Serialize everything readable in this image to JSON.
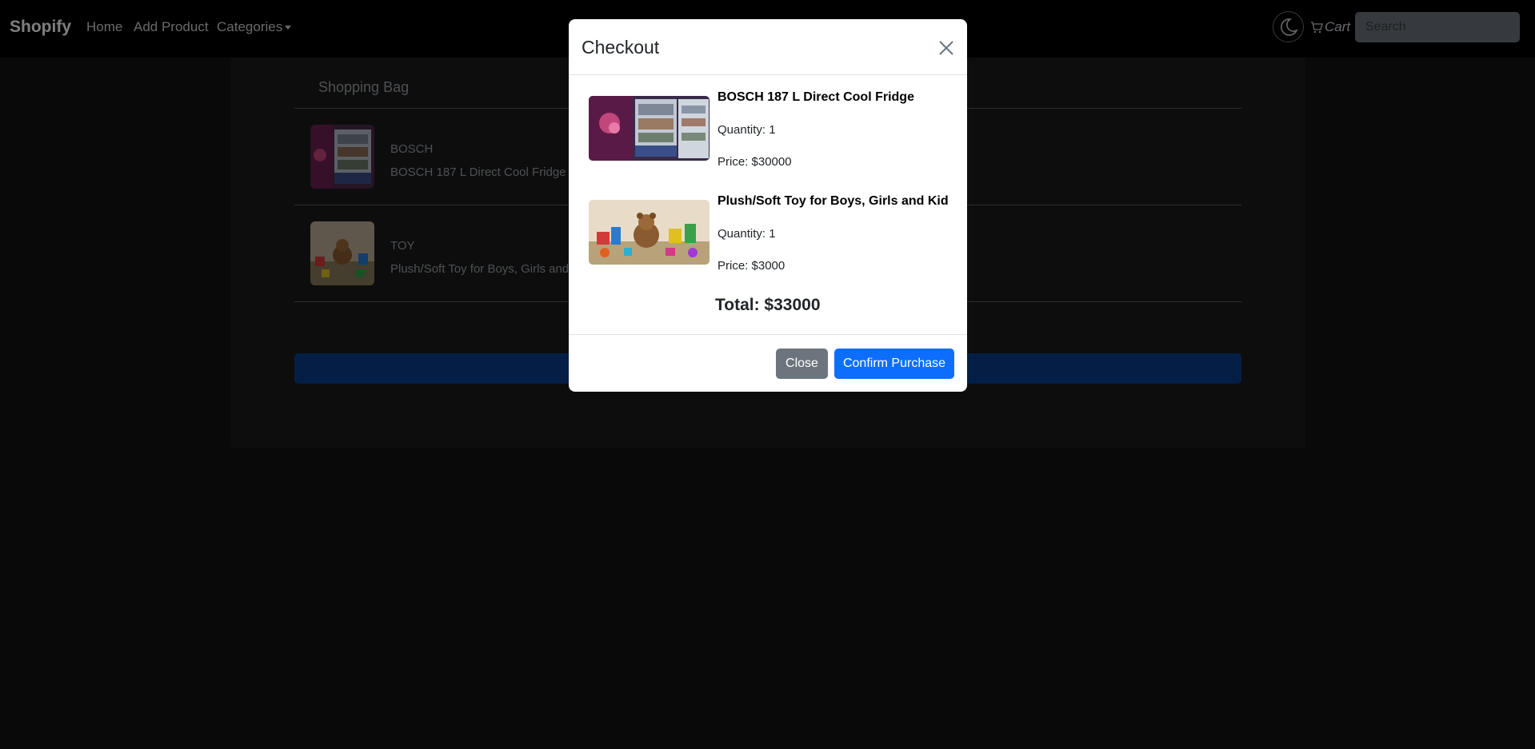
{
  "navbar": {
    "brand": "Shopify",
    "links": {
      "home": "Home",
      "add_product": "Add Product",
      "categories": "Categories"
    },
    "cart_label": "Cart",
    "search_placeholder": "Search"
  },
  "bag": {
    "title": "Shopping Bag",
    "items": [
      {
        "category": "BOSCH",
        "name": "BOSCH 187 L Direct Cool Fridge"
      },
      {
        "category": "TOY",
        "name": "Plush/Soft Toy for Boys, Girls and Kid"
      }
    ]
  },
  "modal": {
    "title": "Checkout",
    "items": [
      {
        "name": "BOSCH 187 L Direct Cool Fridge",
        "quantity": "Quantity: 1",
        "price": "Price: $30000"
      },
      {
        "name": "Plush/Soft Toy for Boys, Girls and Kid",
        "quantity": "Quantity: 1",
        "price": "Price: $3000"
      }
    ],
    "total": "Total: $33000",
    "close_label": "Close",
    "confirm_label": "Confirm Purchase"
  },
  "colors": {
    "primary": "#0d6efd",
    "secondary": "#6c757d",
    "navbar_bg": "#000000",
    "page_bg": "#121212"
  },
  "icons": {
    "theme": "moon-icon",
    "cart": "cart-icon",
    "close": "close-icon"
  }
}
